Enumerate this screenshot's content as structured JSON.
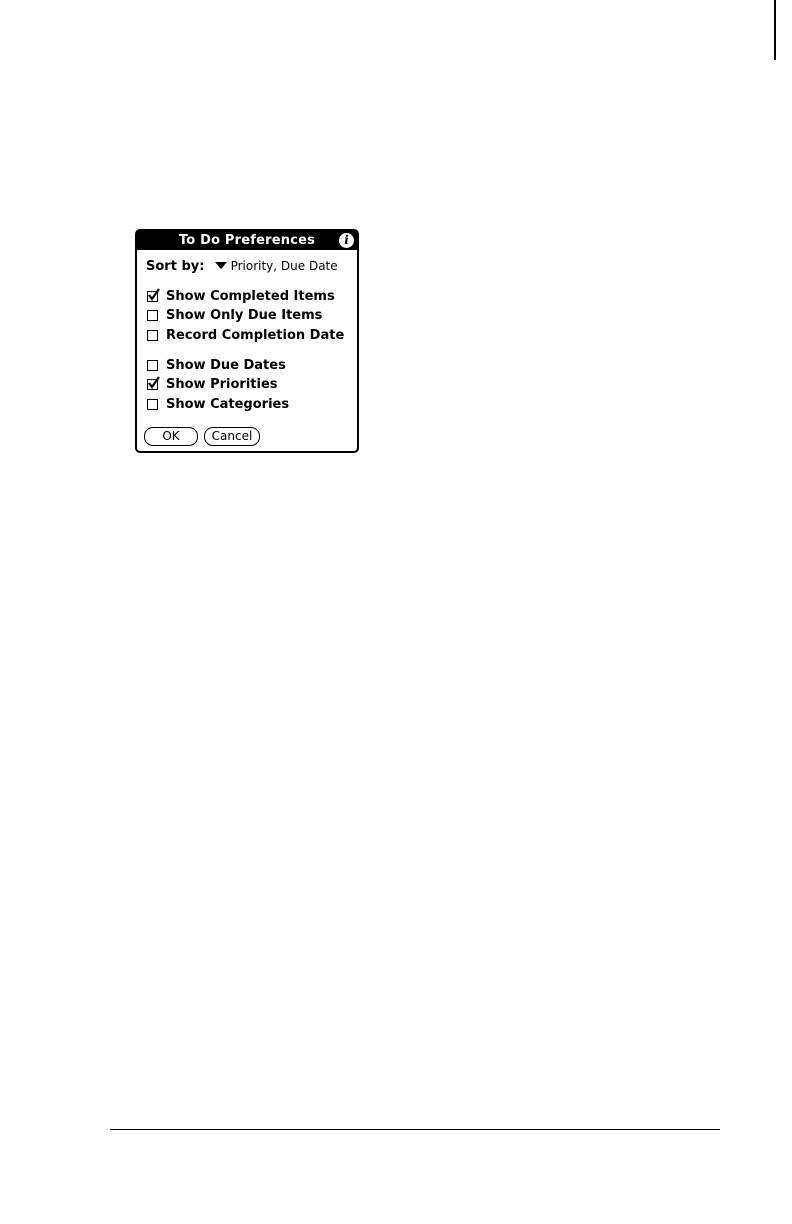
{
  "dialog": {
    "title": "To Do Preferences",
    "info_icon": "info-icon",
    "sort": {
      "label": "Sort by:",
      "value": "Priority, Due Date",
      "icon": "triangle-down-icon"
    },
    "options": [
      {
        "label": "Show Completed Items",
        "checked": true
      },
      {
        "label": "Show Only Due Items",
        "checked": false
      },
      {
        "label": "Record Completion Date",
        "checked": false
      },
      {
        "label": "Show Due Dates",
        "checked": false
      },
      {
        "label": "Show Priorities",
        "checked": true
      },
      {
        "label": "Show Categories",
        "checked": false
      }
    ],
    "buttons": {
      "ok": "OK",
      "cancel": "Cancel"
    }
  }
}
